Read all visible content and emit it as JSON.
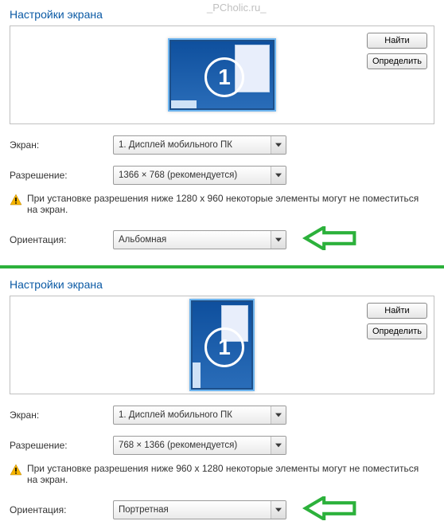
{
  "panels": [
    {
      "title": "Настройки экрана",
      "watermark": "_PCholic.ru_",
      "buttons": {
        "find": "Найти",
        "identify": "Определить"
      },
      "monitor_badge": "1",
      "screen_label": "Экран:",
      "screen_value": "1. Дисплей мобильного ПК",
      "resolution_label": "Разрешение:",
      "resolution_value": "1366 × 768 (рекомендуется)",
      "warning": "При установке разрешения ниже 1280 x 960 некоторые элементы могут не поместиться на экран.",
      "orientation_label": "Ориентация:",
      "orientation_value": "Альбомная"
    },
    {
      "title": "Настройки экрана",
      "buttons": {
        "find": "Найти",
        "identify": "Определить"
      },
      "monitor_badge": "1",
      "screen_label": "Экран:",
      "screen_value": "1. Дисплей мобильного ПК",
      "resolution_label": "Разрешение:",
      "resolution_value": "768 × 1366 (рекомендуется)",
      "warning": "При установке разрешения ниже 960 x 1280 некоторые элементы могут не поместиться на экран.",
      "orientation_label": "Ориентация:",
      "orientation_value": "Портретная"
    }
  ]
}
